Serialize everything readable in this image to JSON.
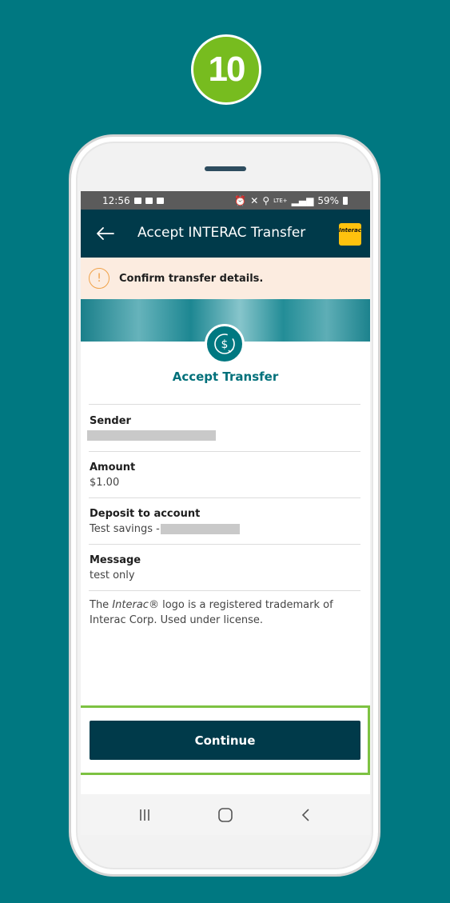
{
  "step": {
    "number": "10"
  },
  "statusbar": {
    "time": "12:56",
    "network": "LTE+",
    "battery": "59%"
  },
  "appbar": {
    "title": "Accept INTERAC Transfer",
    "logo_text": "Interac"
  },
  "alert": {
    "icon": "!",
    "text": "Confirm transfer details."
  },
  "section": {
    "title": "Accept Transfer"
  },
  "details": [
    {
      "label": "Sender",
      "value": ""
    },
    {
      "label": "Amount",
      "value": "$1.00"
    },
    {
      "label": "Deposit to account",
      "value": "Test savings -"
    },
    {
      "label": "Message",
      "value": "test only"
    }
  ],
  "disclaimer": {
    "prefix": "The ",
    "brand": "Interac",
    "suffix": "® logo is a registered trademark of Interac Corp. Used under license."
  },
  "actions": {
    "continue_label": "Continue"
  },
  "colors": {
    "background": "#007881",
    "step_badge": "#77bc1f",
    "appbar": "#003a4a",
    "accent_teal": "#00707a",
    "alert_bg": "#fcece0",
    "alert_icon": "#f0a24a",
    "highlight": "#7dc242",
    "interac_yellow": "#ffc20e"
  }
}
